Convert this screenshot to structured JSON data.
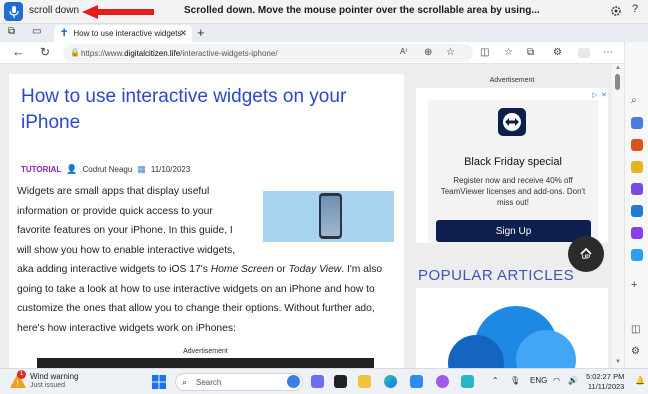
{
  "voice": {
    "command": "scroll down",
    "message": "Scrolled down. Move the mouse pointer over the scrollable area by using..."
  },
  "tab": {
    "title": "How to use interactive widgets o"
  },
  "address": {
    "prefix": "https://www.",
    "domain": "digitalcitizen.life",
    "path": "/interactive-widgets-iphone/"
  },
  "article": {
    "title": "How to use interactive widgets on your iPhone",
    "category": "TUTORIAL",
    "author": "Codrut Neagu",
    "date": "11/10/2023",
    "lines": [
      "Widgets are small apps that display useful",
      "information or provide quick access to your",
      "favorite features on your iPhone. In this guide, I",
      "will show you how to enable interactive widgets,"
    ],
    "line5_a": "aka adding interactive widgets to iOS 17's ",
    "line5_b": "Home Screen",
    "line5_c": " or ",
    "line5_d": "Today View",
    "line5_e": ". I'm also",
    "lines_after": [
      "going to take a look at how to use interactive widgets on an iPhone and how to",
      "customize the ones that allow you to change their options. Without further ado,",
      "here's how interactive widgets work on iPhones:"
    ],
    "ad_label": "Advertisement"
  },
  "sidebar": {
    "ad_label": "Advertisement",
    "ad_heading": "Black Friday special",
    "ad_text": "Register now and receive 40% off TeamViewer licenses and add-ons. Don't miss out!",
    "ad_button": "Sign Up",
    "up_label": "UP",
    "popular": "POPULAR ARTICLES"
  },
  "taskbar": {
    "weather_title": "Wind warning",
    "weather_sub": "Just issued",
    "weather_badge": "1",
    "search": "Search",
    "lang": "ENG",
    "time": "5:02:27 PM",
    "date": "11/11/2023"
  }
}
